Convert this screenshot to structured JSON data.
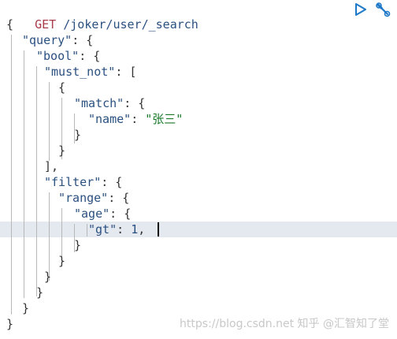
{
  "request": {
    "method": "GET",
    "path": "/joker/user/_search"
  },
  "code": {
    "open_brace": "{",
    "query_key": "\"query\"",
    "bool_key": "\"bool\"",
    "must_not_key": "\"must_not\"",
    "match_key": "\"match\"",
    "name_key": "\"name\"",
    "name_value": "\"张三\"",
    "filter_key": "\"filter\"",
    "range_key": "\"range\"",
    "age_key": "\"age\"",
    "gt_key": "\"gt\"",
    "gt_value": "1"
  },
  "toolbar": {
    "run_icon": "play-icon",
    "settings_icon": "wrench-icon"
  },
  "watermark": "https://blog.csdn.net 知乎 @汇智知了堂",
  "colors": {
    "method": "#a83a4a",
    "key": "#2a5080",
    "string": "#1a7a2a",
    "active_line": "#e4e9ef"
  }
}
